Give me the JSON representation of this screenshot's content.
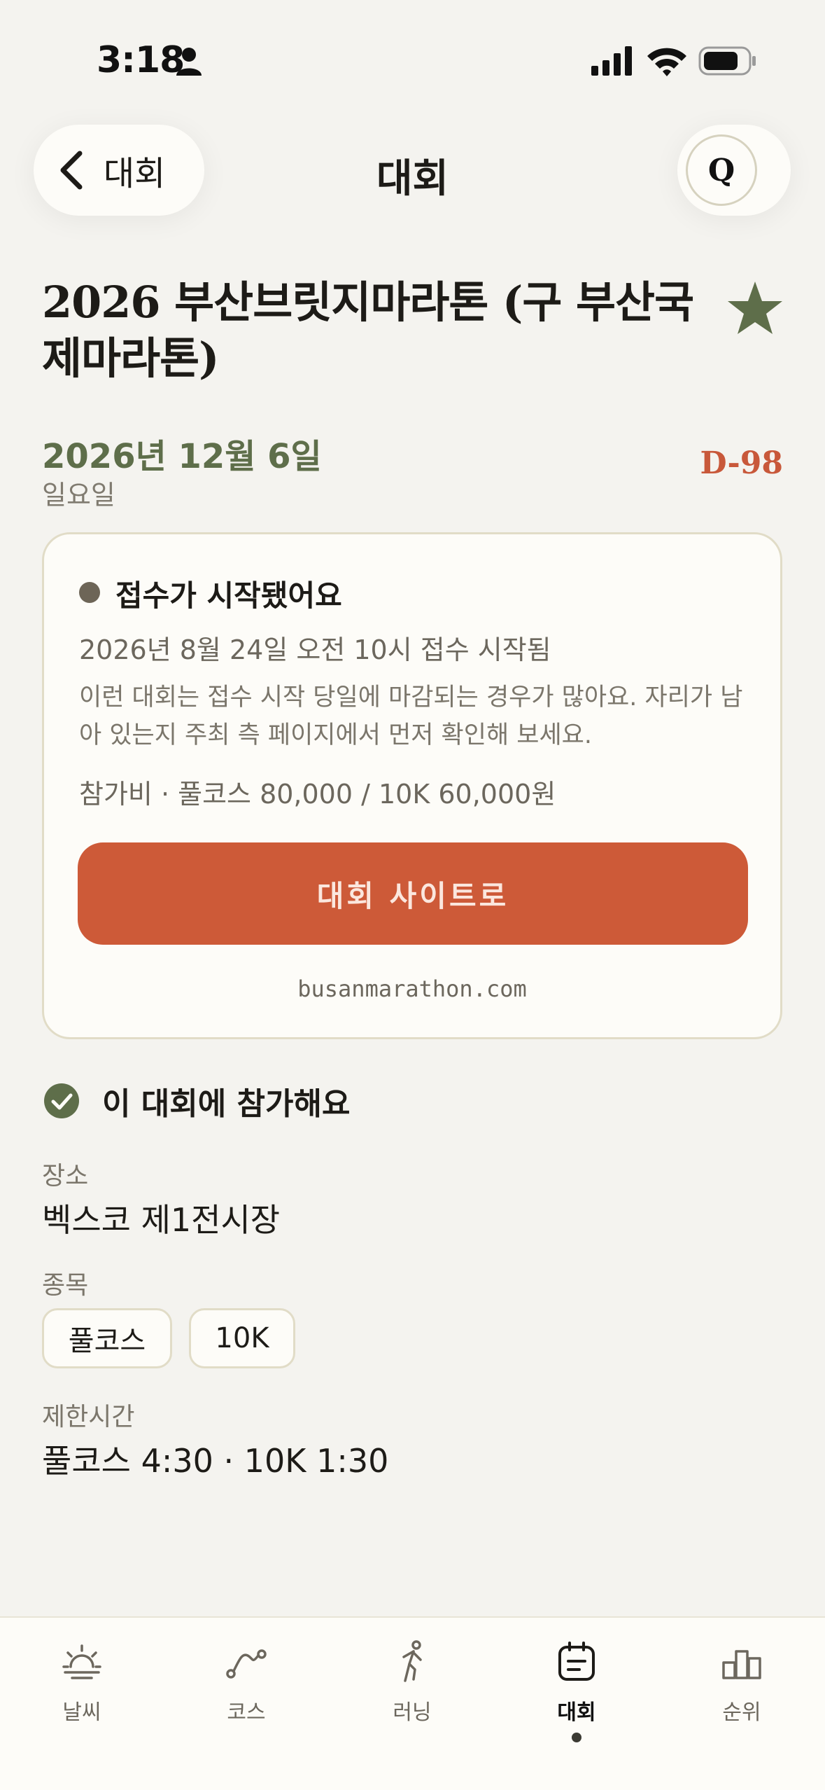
{
  "status_bar": {
    "time": "3:18"
  },
  "header": {
    "back_label": "대회",
    "title": "대회",
    "profile_initial": "Q"
  },
  "event": {
    "title": "2026 부산브릿지마라톤 (구 부산국제마라톤)",
    "date": "2026년 12월 6일",
    "weekday": "일요일",
    "dday": "D-98"
  },
  "registration": {
    "status": "접수가 시작됐어요",
    "start_info": "2026년 8월 24일 오전 10시 접수 시작됨",
    "notice": "이런 대회는 접수 시작 당일에 마감되는 경우가 많아요. 자리가 남아 있는지 주최 측 페이지에서 먼저 확인해 보세요.",
    "fee": "참가비 · 풀코스 80,000 / 10K 60,000원",
    "button_label": "대회 사이트로",
    "site_url": "busanmarathon.com"
  },
  "participate": {
    "label": "이 대회에 참가해요"
  },
  "details": {
    "venue_label": "장소",
    "venue_value": "벡스코 제1전시장",
    "events_label": "종목",
    "events": [
      "풀코스",
      "10K"
    ],
    "time_limit_label": "제한시간",
    "time_limit_value": "풀코스 4:30 · 10K 1:30"
  },
  "tabs": [
    {
      "label": "날씨",
      "icon": "sun-icon"
    },
    {
      "label": "코스",
      "icon": "route-icon"
    },
    {
      "label": "러닝",
      "icon": "runner-icon"
    },
    {
      "label": "대회",
      "icon": "calendar-icon",
      "active": true
    },
    {
      "label": "순위",
      "icon": "podium-icon"
    }
  ],
  "colors": {
    "accent_green": "#5e6e4a",
    "accent_orange": "#cd5a38",
    "background": "#f4f3ef"
  }
}
